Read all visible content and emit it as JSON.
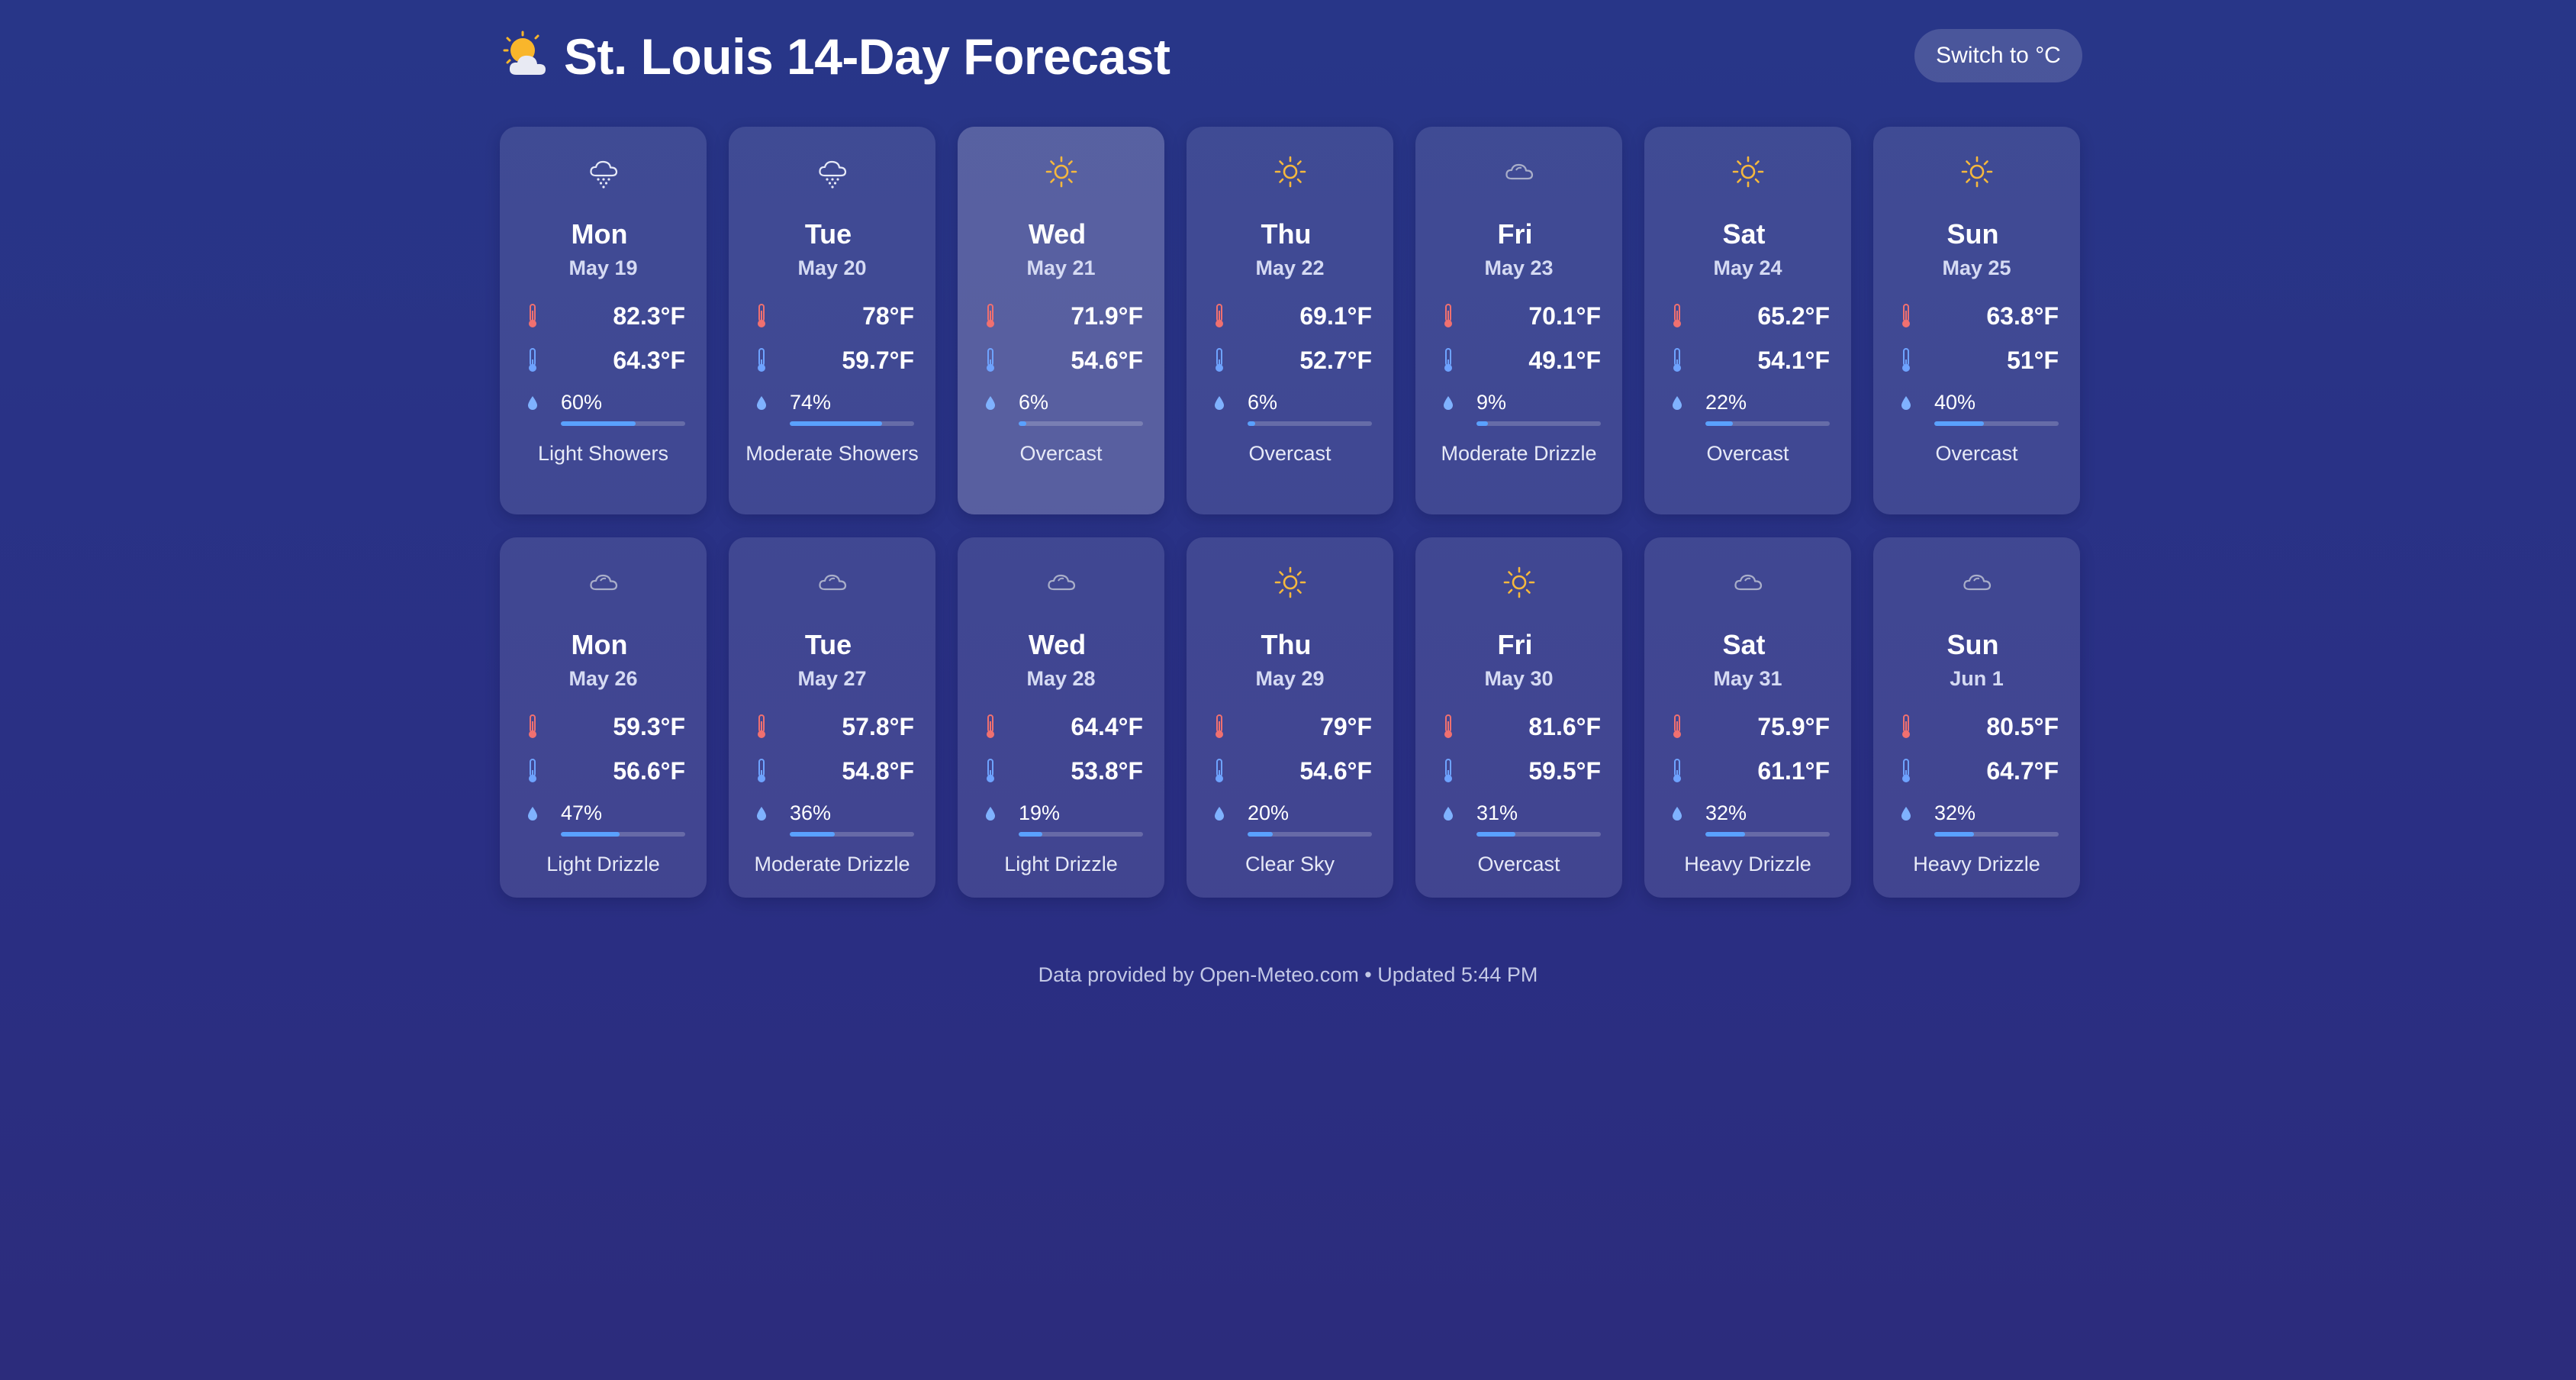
{
  "header": {
    "title": "St. Louis 14-Day Forecast",
    "title_icon": "sun-behind-cloud-icon",
    "unit_button_label": "Switch to °C"
  },
  "colors": {
    "high_temp_icon": "#f07070",
    "low_temp_icon": "#6ea3ff",
    "precip_bar": "#5aa1ff",
    "sun_icon": "#f5b83d",
    "cloud_icon": "#a9aec9"
  },
  "days": [
    {
      "day": "Mon",
      "date": "May 19",
      "high": "82.3°F",
      "low": "64.3°F",
      "precip_label": "60%",
      "precip": 60,
      "condition": "Light Showers",
      "icon": "snow-cloud-icon",
      "active": false
    },
    {
      "day": "Tue",
      "date": "May 20",
      "high": "78°F",
      "low": "59.7°F",
      "precip_label": "74%",
      "precip": 74,
      "condition": "Moderate Showers",
      "icon": "snow-cloud-icon",
      "active": false
    },
    {
      "day": "Wed",
      "date": "May 21",
      "high": "71.9°F",
      "low": "54.6°F",
      "precip_label": "6%",
      "precip": 6,
      "condition": "Overcast",
      "icon": "sun-icon",
      "active": true
    },
    {
      "day": "Thu",
      "date": "May 22",
      "high": "69.1°F",
      "low": "52.7°F",
      "precip_label": "6%",
      "precip": 6,
      "condition": "Overcast",
      "icon": "sun-icon",
      "active": false
    },
    {
      "day": "Fri",
      "date": "May 23",
      "high": "70.1°F",
      "low": "49.1°F",
      "precip_label": "9%",
      "precip": 9,
      "condition": "Moderate Drizzle",
      "icon": "cloud-icon",
      "active": false
    },
    {
      "day": "Sat",
      "date": "May 24",
      "high": "65.2°F",
      "low": "54.1°F",
      "precip_label": "22%",
      "precip": 22,
      "condition": "Overcast",
      "icon": "sun-icon",
      "active": false
    },
    {
      "day": "Sun",
      "date": "May 25",
      "high": "63.8°F",
      "low": "51°F",
      "precip_label": "40%",
      "precip": 40,
      "condition": "Overcast",
      "icon": "sun-icon",
      "active": false
    },
    {
      "day": "Mon",
      "date": "May 26",
      "high": "59.3°F",
      "low": "56.6°F",
      "precip_label": "47%",
      "precip": 47,
      "condition": "Light Drizzle",
      "icon": "cloud-icon",
      "active": false
    },
    {
      "day": "Tue",
      "date": "May 27",
      "high": "57.8°F",
      "low": "54.8°F",
      "precip_label": "36%",
      "precip": 36,
      "condition": "Moderate Drizzle",
      "icon": "cloud-icon",
      "active": false
    },
    {
      "day": "Wed",
      "date": "May 28",
      "high": "64.4°F",
      "low": "53.8°F",
      "precip_label": "19%",
      "precip": 19,
      "condition": "Light Drizzle",
      "icon": "cloud-icon",
      "active": false
    },
    {
      "day": "Thu",
      "date": "May 29",
      "high": "79°F",
      "low": "54.6°F",
      "precip_label": "20%",
      "precip": 20,
      "condition": "Clear Sky",
      "icon": "sun-icon",
      "active": false
    },
    {
      "day": "Fri",
      "date": "May 30",
      "high": "81.6°F",
      "low": "59.5°F",
      "precip_label": "31%",
      "precip": 31,
      "condition": "Overcast",
      "icon": "sun-icon",
      "active": false
    },
    {
      "day": "Sat",
      "date": "May 31",
      "high": "75.9°F",
      "low": "61.1°F",
      "precip_label": "32%",
      "precip": 32,
      "condition": "Heavy Drizzle",
      "icon": "cloud-icon",
      "active": false
    },
    {
      "day": "Sun",
      "date": "Jun 1",
      "high": "80.5°F",
      "low": "64.7°F",
      "precip_label": "32%",
      "precip": 32,
      "condition": "Heavy Drizzle",
      "icon": "cloud-icon",
      "active": false
    }
  ],
  "footer": {
    "text": "Data provided by Open-Meteo.com • Updated 5:44 PM"
  }
}
